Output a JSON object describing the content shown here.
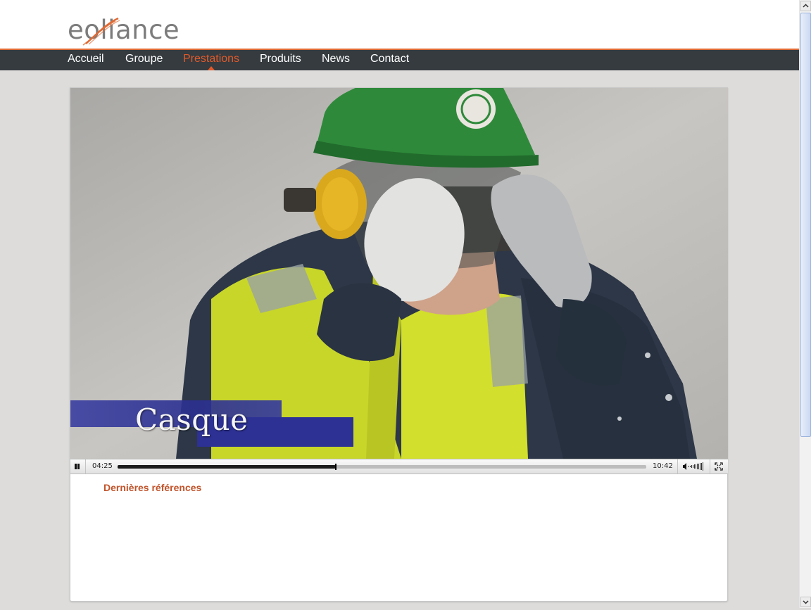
{
  "logo": {
    "text": "eoliance"
  },
  "nav": {
    "items": [
      {
        "label": "Accueil",
        "active": false
      },
      {
        "label": "Groupe",
        "active": false
      },
      {
        "label": "Prestations",
        "active": true
      },
      {
        "label": "Produits",
        "active": false
      },
      {
        "label": "News",
        "active": false
      },
      {
        "label": "Contact",
        "active": false
      }
    ]
  },
  "video": {
    "caption": "Casque",
    "current_time": "04:25",
    "total_time": "10:42",
    "progress": 0.413
  },
  "section": {
    "title": "Dernières références"
  },
  "colors": {
    "accent": "#e05a2b",
    "nav_bg": "#353b3f",
    "page_bg": "#dddcda",
    "section_title": "#c1532a"
  },
  "icons": {
    "pause": "pause-icon",
    "volume": "volume-icon",
    "fullscreen": "fullscreen-icon",
    "scroll_up": "chevron-up-icon",
    "scroll_down": "chevron-down-icon"
  }
}
